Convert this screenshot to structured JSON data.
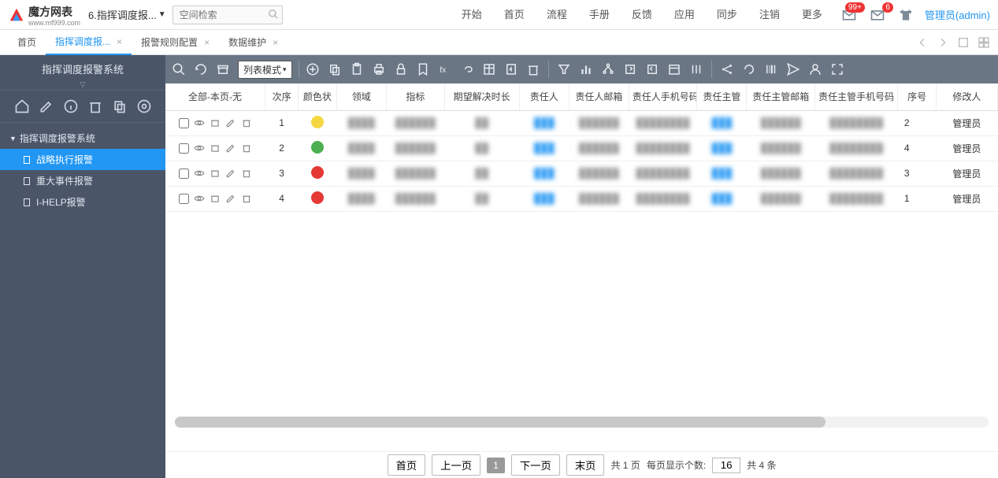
{
  "header": {
    "logo_text": "魔方网表",
    "logo_url": "www.mf999.com",
    "breadcrumb": "6.指挥调度报...",
    "search_placeholder": "空间检索",
    "nav": [
      "开始",
      "首页",
      "流程",
      "手册",
      "反馈",
      "应用",
      "同步",
      "注销",
      "更多"
    ],
    "badge1": "99+",
    "badge2": "6",
    "user": "管理员(admin)"
  },
  "tabs": [
    {
      "label": "首页",
      "closable": false,
      "active": false
    },
    {
      "label": "指挥调度报...",
      "closable": true,
      "active": true
    },
    {
      "label": "报警规则配置",
      "closable": true,
      "active": false
    },
    {
      "label": "数据维护",
      "closable": true,
      "active": false
    }
  ],
  "sidebar": {
    "title": "指挥调度报警系统",
    "root": "指挥调度报警系统",
    "children": [
      {
        "label": "战略执行报警",
        "selected": true
      },
      {
        "label": "重大事件报警",
        "selected": false
      },
      {
        "label": "I-HELP报警",
        "selected": false
      }
    ]
  },
  "toolbar": {
    "mode": "列表模式"
  },
  "table": {
    "header_first": "全部-本页-无",
    "columns": [
      "次序",
      "颜色状",
      "领域",
      "指标",
      "期望解决时长",
      "责任人",
      "责任人邮箱",
      "责任人手机号码",
      "责任主管",
      "责任主管邮箱",
      "责任主管手机号码",
      "序号",
      "修改人"
    ],
    "rows": [
      {
        "num": "1",
        "color": "yellow",
        "seq": "2",
        "mod": "管理员"
      },
      {
        "num": "2",
        "color": "green",
        "seq": "4",
        "mod": "管理员"
      },
      {
        "num": "3",
        "color": "red",
        "seq": "3",
        "mod": "管理员"
      },
      {
        "num": "4",
        "color": "red",
        "seq": "1",
        "mod": "管理员"
      }
    ]
  },
  "pager": {
    "first": "首页",
    "prev": "上一页",
    "cur": "1",
    "next": "下一页",
    "last": "末页",
    "pages": "共 1 页",
    "size_label": "每页显示个数:",
    "size": "16",
    "total": "共 4 条"
  }
}
